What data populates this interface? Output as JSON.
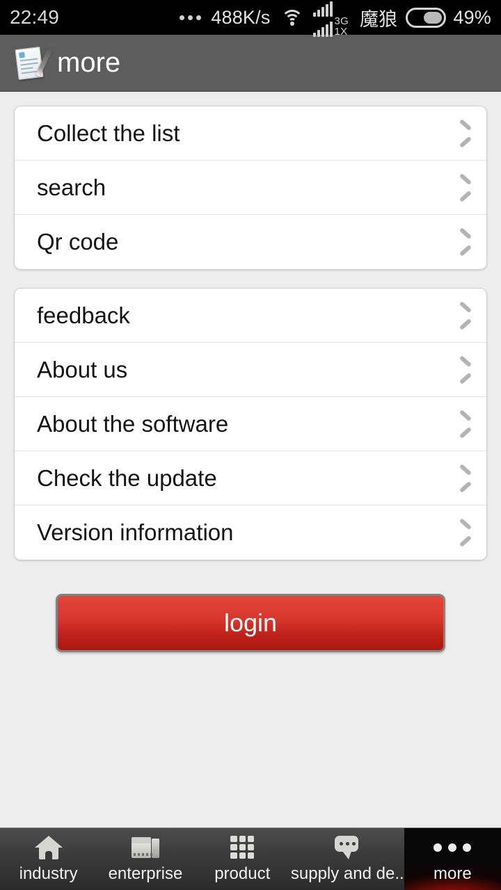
{
  "status_bar": {
    "clock": "22:49",
    "dots_icon": "ellipsis-icon",
    "data_rate": "488K/s",
    "wifi_icon": "wifi-icon",
    "signal_label_top": "3G",
    "signal_label_bottom": "1X",
    "carrier": "魔狼",
    "battery_icon": "battery-icon",
    "battery_percent": "49%"
  },
  "app_bar": {
    "icon": "document-pen-icon",
    "title": "more"
  },
  "groups": [
    {
      "rows": [
        {
          "label": "Collect the list",
          "chevron": "chevron-right-icon"
        },
        {
          "label": "search",
          "chevron": "chevron-right-icon"
        },
        {
          "label": "Qr code",
          "chevron": "chevron-right-icon"
        }
      ]
    },
    {
      "rows": [
        {
          "label": "feedback",
          "chevron": "chevron-right-icon"
        },
        {
          "label": "About us",
          "chevron": "chevron-right-icon"
        },
        {
          "label": "About the software",
          "chevron": "chevron-right-icon"
        },
        {
          "label": "Check the update",
          "chevron": "chevron-right-icon"
        },
        {
          "label": "Version information",
          "chevron": "chevron-right-icon"
        }
      ]
    }
  ],
  "login": {
    "label": "login"
  },
  "tab_bar": {
    "active_index": 4,
    "tabs": [
      {
        "label": "industry",
        "icon": "home-icon"
      },
      {
        "label": "enterprise",
        "icon": "factory-icon"
      },
      {
        "label": "product",
        "icon": "grid-icon"
      },
      {
        "label": "supply and de..",
        "icon": "chat-bubble-icon"
      },
      {
        "label": "more",
        "icon": "ellipsis-icon"
      }
    ]
  },
  "colors": {
    "header_gray": "#5d5d5d",
    "page_background": "#ededed",
    "login_red_top": "#e2463b",
    "login_red_bottom": "#ab1710",
    "active_tab_red": "#c0160c",
    "chevron_gray": "#b4b4b4"
  }
}
